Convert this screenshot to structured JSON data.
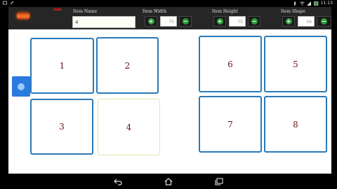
{
  "status_bar": {
    "time": "11:13",
    "icons": [
      "notification-icon",
      "wrench-icon",
      "vibrate-icon",
      "wifi-icon",
      "signal-icon",
      "battery-icon"
    ]
  },
  "toolbar": {
    "item_name": {
      "label": "Item Name",
      "value": "4"
    },
    "item_width": {
      "label": "Item Width",
      "value": "75"
    },
    "item_height": {
      "label": "Item Height",
      "value": "75"
    },
    "item_shape": {
      "label": "Item Shape",
      "value": "16"
    },
    "plus_glyph": "+",
    "minus_glyph": "−"
  },
  "tiles": [
    "1",
    "2",
    "3",
    "4",
    "6",
    "5",
    "7",
    "8"
  ],
  "selected_tile": "4",
  "colors": {
    "tile_border": "#2a7ab8",
    "tile_label": "#6a1414",
    "selected_border": "#e6e3b0",
    "plus_button": "#2e9e3a",
    "toolbar_bg": "#262626",
    "handle": "#2a7ae0"
  },
  "nav_bar": {
    "icons": [
      "back-icon",
      "home-icon",
      "recent-apps-icon"
    ]
  }
}
